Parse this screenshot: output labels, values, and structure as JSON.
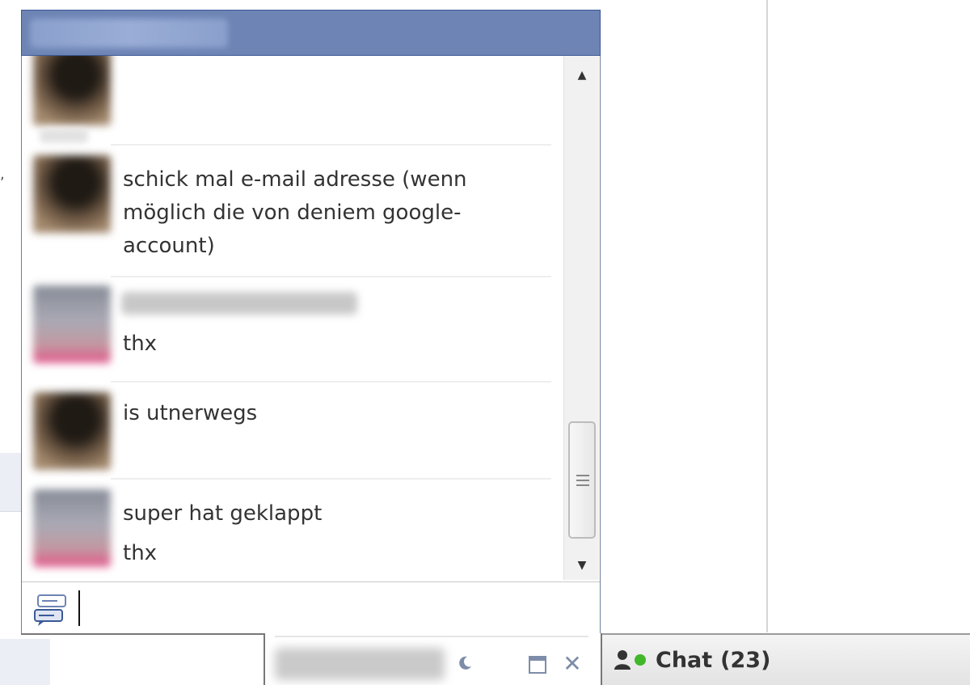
{
  "background": {
    "stray_mark": ","
  },
  "chat_window": {
    "messages": [
      {
        "sender": "friend",
        "lines": []
      },
      {
        "sender": "friend",
        "lines": [
          "schick mal e-mail adresse (wenn",
          "möglich die von deniem google-",
          "account)"
        ]
      },
      {
        "sender": "me",
        "lines": [
          "thx"
        ]
      },
      {
        "sender": "friend",
        "lines": [
          "is utnerwegs"
        ]
      },
      {
        "sender": "me",
        "lines": [
          "super hat geklappt",
          "thx"
        ]
      }
    ],
    "input": {
      "value": ""
    },
    "icons": {
      "scroll_up": "▲",
      "scroll_down": "▼",
      "emote": "emote-icon"
    }
  },
  "tab_bar": {
    "friend_tab": {
      "close_glyph": "✕",
      "status_icon": "moon-icon"
    },
    "chat_bar": {
      "label": "Chat",
      "count": "(23)",
      "online_color": "#42b72a"
    }
  },
  "colors": {
    "titlebar": "#6d84b4",
    "border": "#3b5998"
  }
}
